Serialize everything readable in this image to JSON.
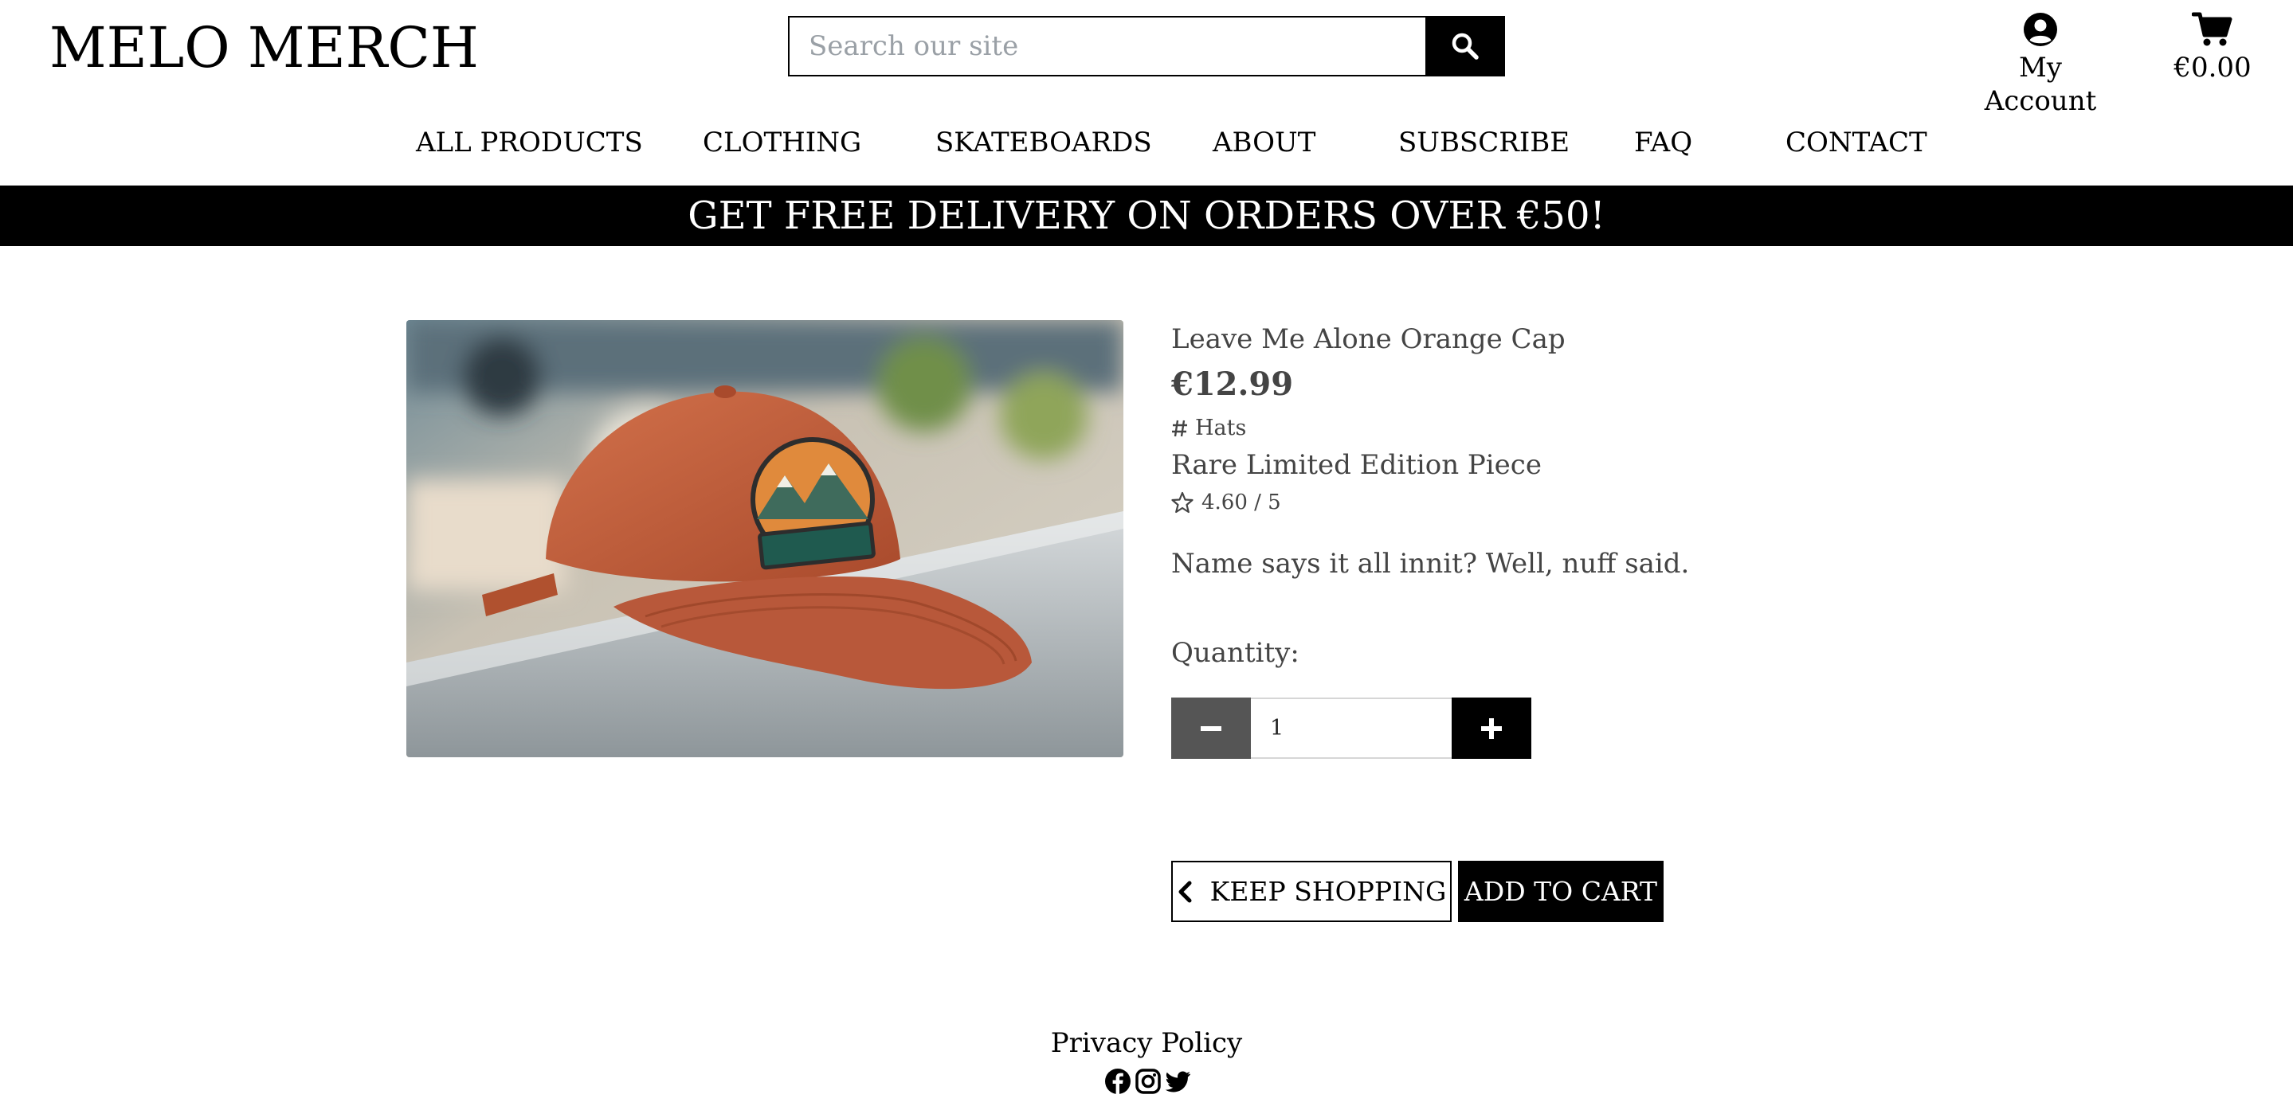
{
  "header": {
    "brand": "MELO MERCH",
    "search_placeholder": "Search our site",
    "account_label": "My Account",
    "cart_total": "€0.00",
    "icons": {
      "search": "search-icon",
      "account": "user-circle-icon",
      "cart": "shopping-cart-icon"
    }
  },
  "nav": {
    "items": [
      {
        "label": "ALL PRODUCTS"
      },
      {
        "label": "CLOTHING"
      },
      {
        "label": "SKATEBOARDS"
      },
      {
        "label": "ABOUT"
      },
      {
        "label": "SUBSCRIBE"
      },
      {
        "label": "FAQ"
      },
      {
        "label": "CONTACT"
      }
    ]
  },
  "banner": {
    "text": "GET FREE DELIVERY ON ORDERS OVER €50!"
  },
  "product": {
    "name": "Leave Me Alone Orange Cap",
    "price": "€12.99",
    "category": "Hats",
    "badge": "Rare Limited Edition Piece",
    "rating": "4.60 / 5",
    "description": "Name says it all innit? Well, nuff said.",
    "quantity_label": "Quantity:",
    "quantity_value": "1",
    "image_alt": "Orange cap with mountain patch resting on a concrete ledge"
  },
  "actions": {
    "keep_shopping": "KEEP SHOPPING",
    "add_to_cart": "ADD TO CART"
  },
  "footer": {
    "privacy": "Privacy Policy",
    "social_icons": [
      "facebook-icon",
      "instagram-icon",
      "twitter-icon"
    ]
  },
  "colors": {
    "primary": "#000000",
    "background": "#ffffff",
    "text_muted": "#444444",
    "stepper_minus": "#555555",
    "cap": "#c25e3c"
  }
}
